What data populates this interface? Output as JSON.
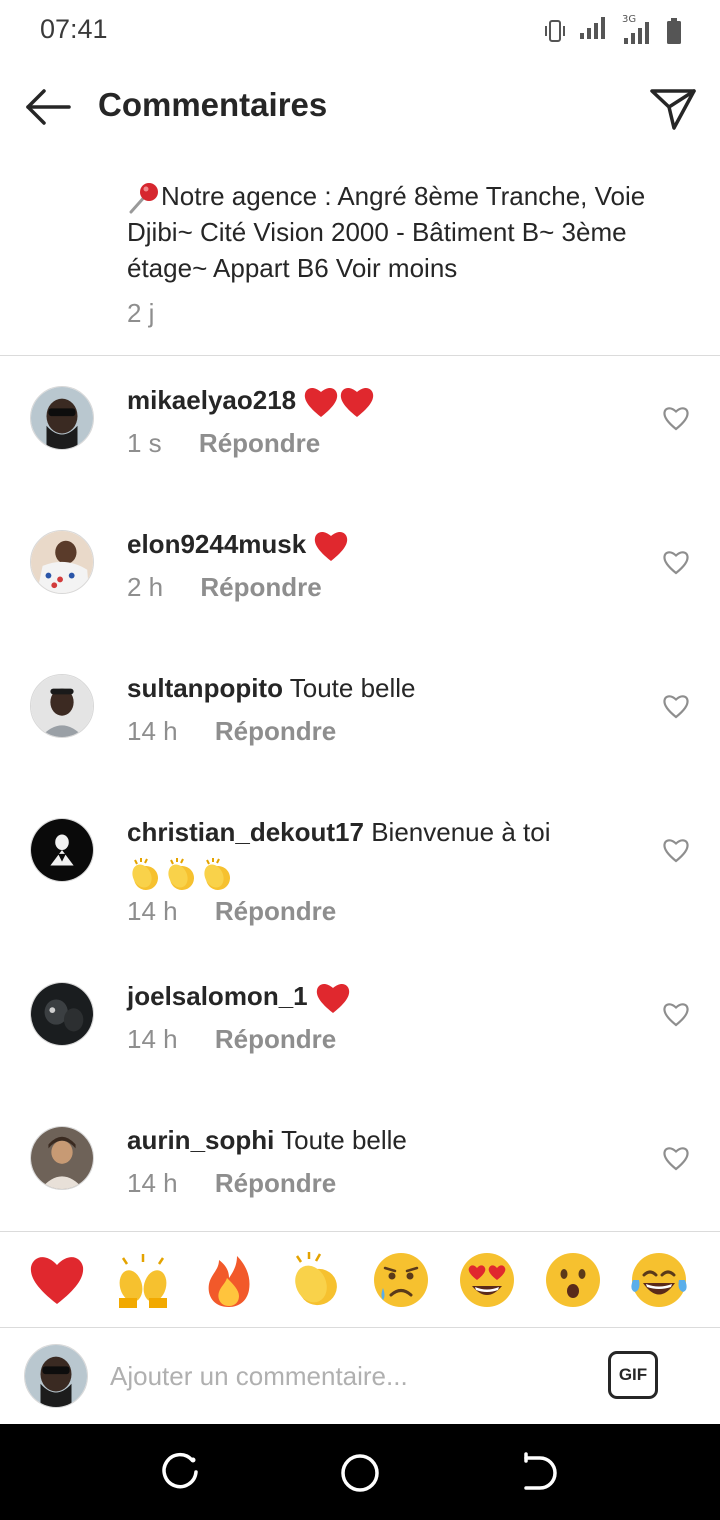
{
  "status_bar": {
    "time": "07:41",
    "network_label": "3G",
    "icons": [
      "vibrate-icon",
      "signal-icon",
      "signal-icon",
      "battery-icon"
    ]
  },
  "header": {
    "title": "Commentaires",
    "back_icon": "arrow-left-icon",
    "send_icon": "paper-plane-icon"
  },
  "caption": {
    "pin_icon": "round-pushpin-emoji",
    "text": "Notre agence : Angré 8ème Tranche, Voie Djibi~ Cité Vision 2000 - Bâtiment B~ 3ème étage~ Appart B6",
    "see_less": "Voir moins",
    "time": "2 j"
  },
  "comments": [
    {
      "username": "mikaelyao218",
      "text": "",
      "emoji_count": 2,
      "emoji": "red-heart-emoji",
      "time": "1 s",
      "reply": "Répondre"
    },
    {
      "username": "elon9244musk",
      "text": "",
      "emoji_count": 1,
      "emoji": "red-heart-emoji",
      "time": "2 h",
      "reply": "Répondre"
    },
    {
      "username": "sultanpopito",
      "text": "Toute belle",
      "emoji_count": 0,
      "time": "14 h",
      "reply": "Répondre"
    },
    {
      "username": "christian_dekout17",
      "text": "Bienvenue à toi",
      "emoji_count": 3,
      "emoji": "clapping-hands-emoji",
      "time": "14 h",
      "reply": "Répondre"
    },
    {
      "username": "joelsalomon_1",
      "text": "",
      "emoji_count": 1,
      "emoji": "red-heart-emoji",
      "time": "14 h",
      "reply": "Répondre"
    },
    {
      "username": "aurin_sophi",
      "text": "Toute belle",
      "emoji_count": 0,
      "time": "14 h",
      "reply": "Répondre"
    }
  ],
  "reactions": [
    "red-heart-emoji",
    "raising-hands-emoji",
    "fire-emoji",
    "clapping-hands-emoji",
    "sad-but-relieved-face-emoji",
    "heart-eyes-face-emoji",
    "open-mouth-face-emoji",
    "tears-of-joy-face-emoji"
  ],
  "composer": {
    "placeholder": "Ajouter un commentaire...",
    "gif_label": "GIF"
  },
  "nav_bar": {
    "buttons": [
      "recents-button",
      "home-button",
      "back-button"
    ]
  },
  "colors": {
    "text_primary": "#262626",
    "text_secondary": "#8e8e8e",
    "divider": "#dbdbdb",
    "heart_red": "#e0282e",
    "emoji_yellow": "#f6c12f"
  }
}
